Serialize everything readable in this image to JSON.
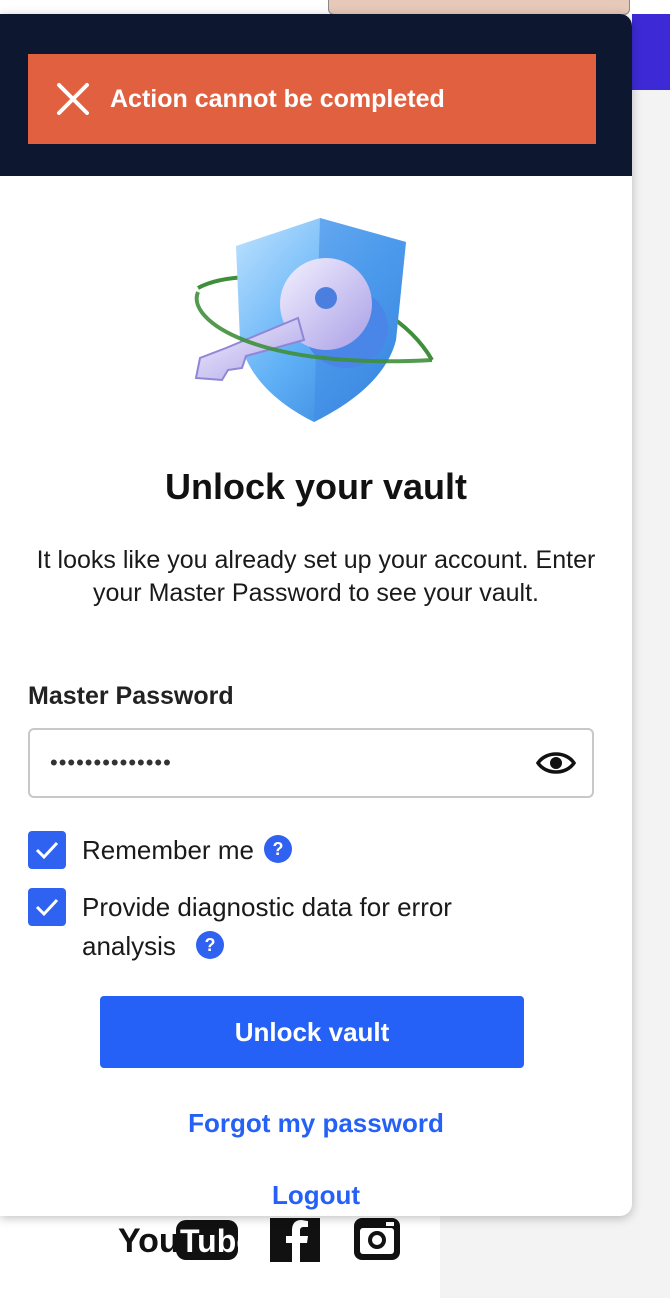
{
  "toast": {
    "message": "Action cannot be completed",
    "color": "#e0603f"
  },
  "header": {
    "background": "#0e1730"
  },
  "vault": {
    "title": "Unlock your vault",
    "description": "It looks like you already set up your account. Enter your Master Password to see your vault."
  },
  "password": {
    "label": "Master Password",
    "value": "••••••••••••••"
  },
  "options": {
    "remember_me": {
      "label": "Remember me",
      "checked": true
    },
    "diagnostics": {
      "label": "Provide diagnostic data for error analysis",
      "checked": true
    }
  },
  "actions": {
    "unlock_label": "Unlock vault",
    "forgot_label": "Forgot my password",
    "logout_label": "Logout"
  },
  "accent_color": "#2561f6",
  "background_page": {
    "social_icons": [
      "youtube-icon",
      "facebook-icon",
      "instagram-icon"
    ]
  }
}
